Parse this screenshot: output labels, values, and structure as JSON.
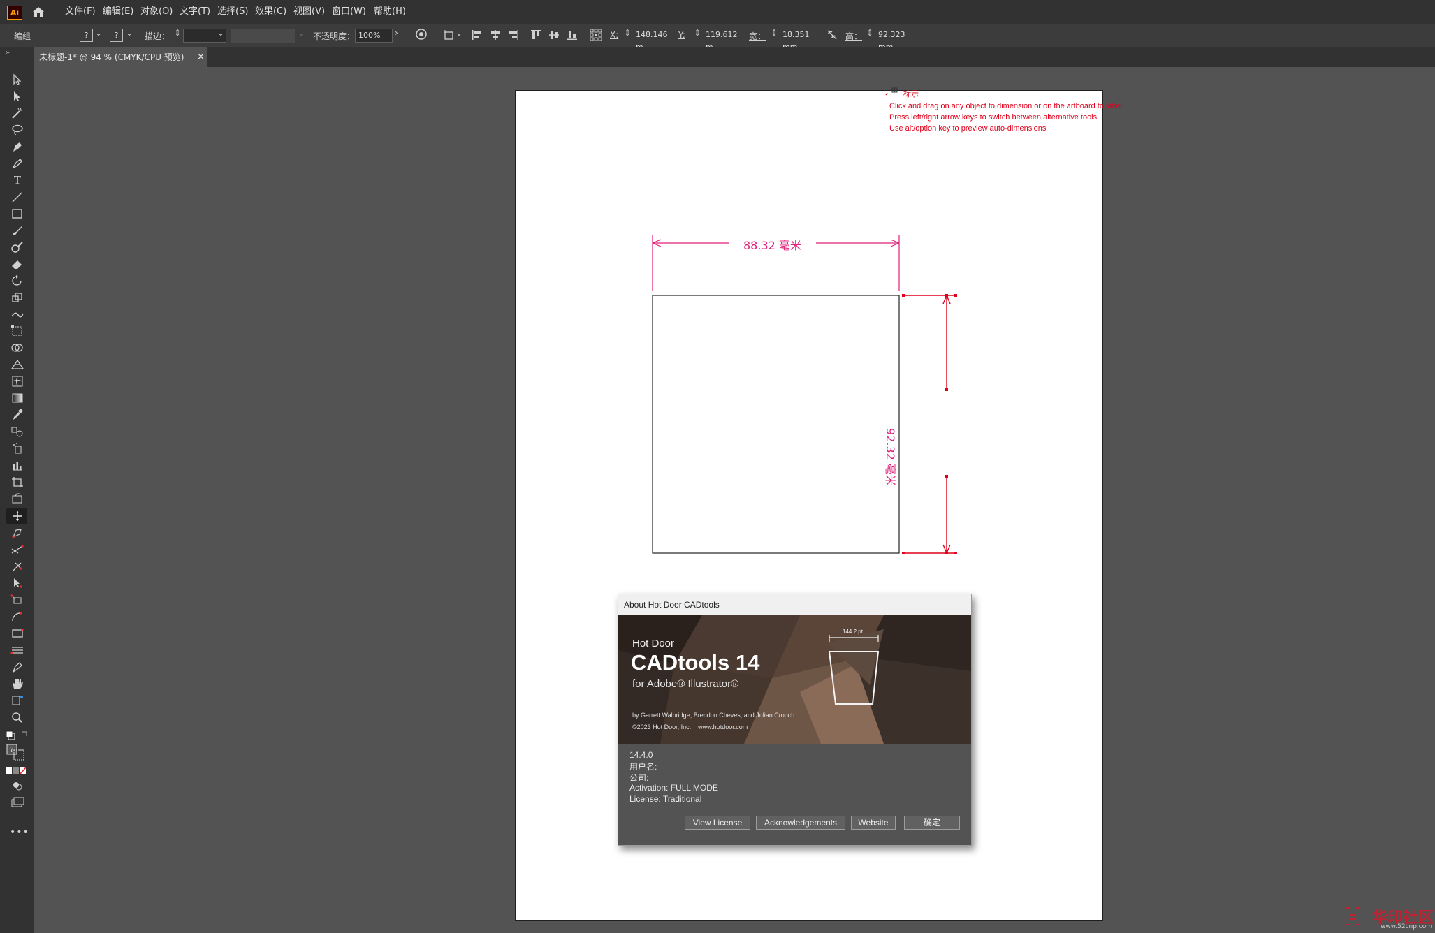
{
  "app": {
    "logo_text": "Ai"
  },
  "menu": [
    "文件(F)",
    "编辑(E)",
    "对象(O)",
    "文字(T)",
    "选择(S)",
    "效果(C)",
    "视图(V)",
    "窗口(W)",
    "帮助(H)"
  ],
  "control_bar": {
    "selection_label": "编组",
    "fill_glyph": "?",
    "stroke_glyph": "?",
    "stroke_label": "描边：",
    "opacity_label": "不透明度：",
    "opacity_value": "100%",
    "x_label": "X:",
    "x_value": "148.146 m",
    "y_label": "Y:",
    "y_value": "119.612 m",
    "w_label": "宽：",
    "w_value": "18.351 mm",
    "h_label": "高：",
    "h_value": "92.323 mm"
  },
  "document_tab": {
    "title": "未标题-1* @ 94 % (CMYK/CPU 预览)",
    "close": "×"
  },
  "canvas": {
    "cursor_label": "标示",
    "hints": [
      "Click and drag on any object to dimension or on the artboard to label",
      "Press left/right arrow keys to switch between alternative tools",
      "Use alt/option key to preview auto-dimensions"
    ],
    "dimension_width": "88.32 毫米",
    "dimension_height": "92.32 毫米",
    "dimension_color": "#e0207a"
  },
  "about_dialog": {
    "title": "About Hot Door CADtools",
    "brand": "Hot Door",
    "product": "CADtools 14",
    "for_line": "for Adobe® Illustrator®",
    "banner_measure": "144.2 pt",
    "credits": "by Garrett Walbridge, Brendon Cheves, and Julian Crouch",
    "copyright": "©2023 Hot Door, Inc.    www.hotdoor.com",
    "version": "14.4.0",
    "user_name": "用户名:",
    "company": "公司:",
    "activation": "Activation: FULL MODE",
    "license": "License: Traditional",
    "buttons": [
      "View License",
      "Acknowledgements",
      "Website",
      "确定"
    ]
  },
  "watermark": {
    "site": "华印社区",
    "url": "www.52cnp.com"
  },
  "colors": {
    "accent_red": "#e0001a",
    "dimension_pink": "#e0207a",
    "ui_dark": "#323232",
    "canvas_gray": "#535353"
  }
}
